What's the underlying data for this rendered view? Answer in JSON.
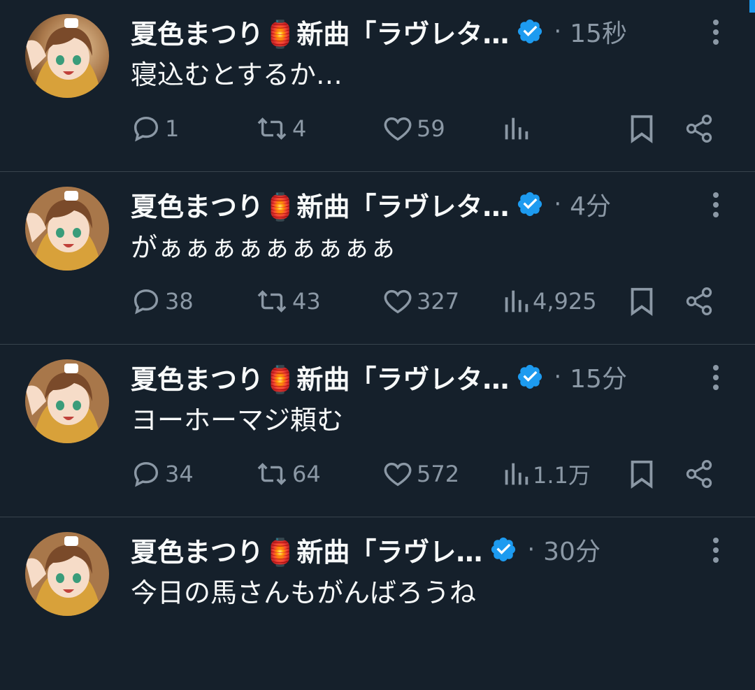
{
  "colors": {
    "background": "#15202b",
    "text": "#f7f9f9",
    "muted": "#8b98a5",
    "verified": "#1d9bf0",
    "divider": "#38444d"
  },
  "tweets": [
    {
      "name": "夏色まつり🏮新曲「ラヴレタ…",
      "time": "15秒",
      "text": "寝込むとするか…",
      "replies": "1",
      "retweets": "4",
      "likes": "59",
      "views": ""
    },
    {
      "name": "夏色まつり🏮新曲「ラヴレタ…",
      "time": "4分",
      "text": "がぁぁぁぁぁぁぁぁぁ",
      "replies": "38",
      "retweets": "43",
      "likes": "327",
      "views": "4,925"
    },
    {
      "name": "夏色まつり🏮新曲「ラヴレタ…",
      "time": "15分",
      "text": "ヨーホーマジ頼む",
      "replies": "34",
      "retweets": "64",
      "likes": "572",
      "views": "1.1万"
    },
    {
      "name": "夏色まつり🏮新曲「ラヴレ…",
      "time": "30分",
      "text": "今日の馬さんもがんばろうね",
      "replies": "",
      "retweets": "",
      "likes": "",
      "views": ""
    }
  ],
  "separator_dot": "·",
  "icons": {
    "verified": "verified-badge-icon",
    "more": "more-vertical-icon",
    "reply": "reply-bubble-icon",
    "retweet": "retweet-icon",
    "like": "heart-icon",
    "views": "analytics-bars-icon",
    "bookmark": "bookmark-icon",
    "share": "share-icon"
  }
}
